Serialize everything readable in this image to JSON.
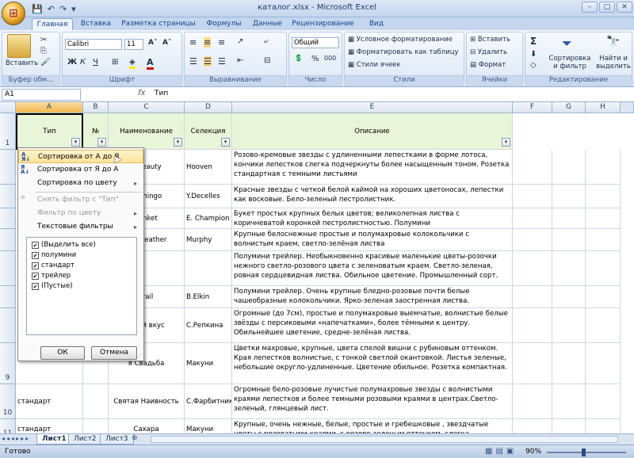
{
  "title": {
    "text": "каталог.xlsx - Microsoft Excel",
    "qat": [
      "💾",
      "↶",
      "↷",
      "▾"
    ]
  },
  "tabs": [
    "Главная",
    "Вставка",
    "Разметка страницы",
    "Формулы",
    "Данные",
    "Рецензирование",
    "Вид"
  ],
  "ribbon": {
    "clipboard": {
      "paste": "Вставить",
      "label": "Буфер обм..."
    },
    "font": {
      "name": "Calibri",
      "size": "11",
      "bold": "Ж",
      "italic": "К",
      "underline": "Ч",
      "grow": "A˄",
      "shrink": "A˅",
      "fill_letter": "A",
      "label": "Шрифт"
    },
    "align": {
      "label": "Выравнивание"
    },
    "number": {
      "format": "Общий",
      "percent": "%",
      "thousands": "000",
      "label": "Число"
    },
    "styles": {
      "cond": "Условное форматирование",
      "table": "Форматировать как таблицу",
      "cell": "Стили ячеек",
      "label": "Стили"
    },
    "cells": {
      "insert": "Вставить",
      "delete": "Удалить",
      "format": "Формат",
      "label": "Ячейки"
    },
    "editing": {
      "sum": "Σ",
      "sort": "Сортировка\nи фильтр",
      "find": "Найти и\nвыделить",
      "label": "Редактирование"
    }
  },
  "formula_bar": {
    "name_box": "A1",
    "fx": "fx",
    "content": "Тип"
  },
  "columns": [
    "A",
    "B",
    "C",
    "D",
    "E",
    "F",
    "G",
    "H"
  ],
  "header": {
    "A": "Тип",
    "B": "№",
    "C": "Наименование",
    "D": "Селекция",
    "E": "Описание"
  },
  "rows": [
    {
      "num": "",
      "c": "a Beauty",
      "d": "Hooven",
      "e": "Розово-кремовые звезды с удлиненными лепестками в форме лотоса, кончики лепестков слегка подчеркнуты более насыщенным тоном. Розетка стандартная с темными листьями"
    },
    {
      "num": "",
      "c": "Flamingo",
      "d": "Y.Decelles",
      "e": "Красные звезды с четкой белой каймой на хороших цветоносах, лепестки как восковые. Бело-зеленый пестролистник."
    },
    {
      "num": "",
      "c": "Trinket",
      "d": "E. Champion",
      "e": "Букет простых крупных белых цветов; великолепная листва с коричневатой коронкой пестролистностью. Полумини"
    },
    {
      "num": "",
      "c": "hite Feather",
      "d": "Murphy",
      "e": "Крупные белоснежные простые и полумахровые колокольчики с волнистым краем, светло-зелёная листва"
    },
    {
      "num": "",
      "c": "",
      "d": "",
      "e": "Полумини трейлер. Необыкновенно красивые маленькие цветы-розочки нежного светло-розового цвета с зеленоватым краем. Светло-зеленая, ровная сердцевидная листва. Обильное цветение. Промышленный сорт."
    },
    {
      "num": "",
      "c": "Trail",
      "d": "B.Elkin",
      "e": "Полумини трейлер. Очень крупные бледно-розовые почти белые чашеобразные колокольчики. Ярко-зеленая заостренная листва."
    },
    {
      "num": "",
      "c": "нный вкус",
      "d": "С.Репкина",
      "e": "Огромные (до 7см), простые и полумахровые выемчатые, волнистые белые звёзды с персиковыми «напечатками», более тёмными к центру. Обильнейшее цветение, средне-зелёная листва."
    },
    {
      "num": "9",
      "c": "я Свадьба",
      "d": "Макуни",
      "e": "Цветки махровые, крупные, цвета спелой вишни с рубиновым оттенком. Края лепестков волнистые, с тонкой светлой окантовкой. Листья зеленые, небольшие округло-удлиненные. Цветение обильное. Розетка компактная."
    },
    {
      "num": "10",
      "a": "стандарт",
      "c": "Святая Наивность",
      "d": "С.Фарбитник",
      "e": "Огромные бело-розовые лучистые полумахровые звезды с волнистыми краями лепестков и более темными розовыми краями в центрах.Светло-зеленый, глянцевый лист."
    },
    {
      "num": "11",
      "a": "стандарт",
      "c": "Сахара",
      "d": "Макуни",
      "e": "Крупные, очень нежные, белые, простые и гребешковые , звездчатые цветы с розоватыми краями, с розово-зеленым оттенком, слегка гофрированные и"
    }
  ],
  "menu": {
    "sort_az": "Сортировка от А до Я",
    "sort_za": "Сортировка от Я до А",
    "sort_color": "Сортировка по цвету",
    "clear": "Снять фильтр с \"Тип\"",
    "filter_color": "Фильтр по цвету",
    "text_filters": "Текстовые фильтры",
    "items": [
      "(Выделить все)",
      "полумини",
      "стандарт",
      "трейлер",
      "(Пустые)"
    ],
    "ok": "ОК",
    "cancel": "Отмена"
  },
  "sheets": [
    "Лист1",
    "Лист2",
    "Лист3"
  ],
  "status": {
    "ready": "Готово",
    "zoom": "90%"
  }
}
